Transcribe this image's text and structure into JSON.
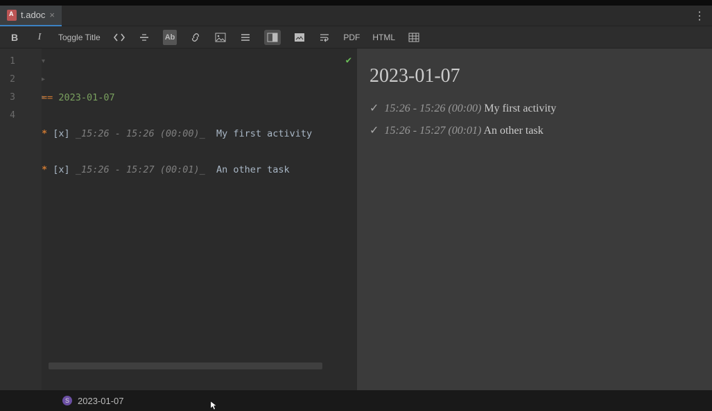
{
  "tab": {
    "filename": "t.adoc"
  },
  "toolbar": {
    "bold": "B",
    "italic": "I",
    "toggle_title": "Toggle Title",
    "ab": "Ab",
    "pdf": "PDF",
    "html": "HTML"
  },
  "editor": {
    "lines": [
      "1",
      "2",
      "3",
      "4"
    ],
    "heading_marker": "==",
    "heading_text": "2023-01-07",
    "items": [
      {
        "star": "*",
        "box": "[x]",
        "time": "_15:26 - 15:26 (00:00)_",
        "desc": "My first activity"
      },
      {
        "star": "*",
        "box": "[x]",
        "time": "_15:26 - 15:27 (00:01)_",
        "desc": "An other task"
      }
    ]
  },
  "preview": {
    "heading": "2023-01-07",
    "items": [
      {
        "check": "✓",
        "time": "15:26 - 15:26 (00:00)",
        "desc": "My first activity"
      },
      {
        "check": "✓",
        "time": "15:26 - 15:27 (00:01)",
        "desc": "An other task"
      }
    ]
  },
  "status": {
    "badge": "S",
    "text": "2023-01-07"
  }
}
